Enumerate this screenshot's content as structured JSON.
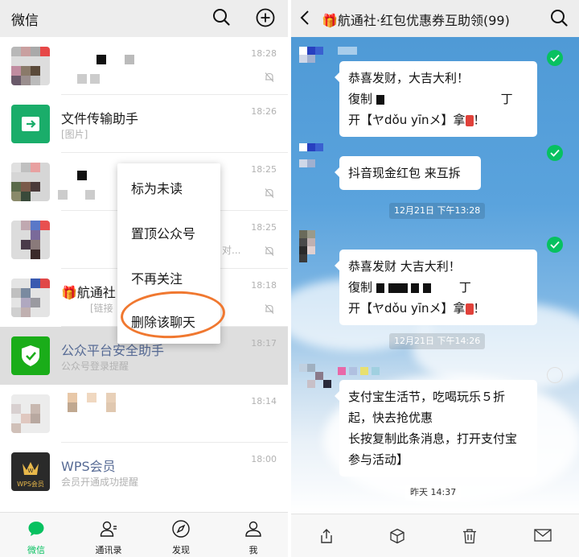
{
  "left": {
    "header_title": "微信",
    "chats": [
      {
        "name": "",
        "sub": "",
        "time": "18:28",
        "muted": true
      },
      {
        "name": "文件传输助手",
        "sub": "[图片]",
        "time": "18:26",
        "muted": false
      },
      {
        "name": "",
        "sub": "",
        "time": "18:25",
        "muted": true
      },
      {
        "name": "",
        "sub": "对...",
        "time": "18:25",
        "muted": true
      },
      {
        "name": "航通社",
        "sub": "[链接",
        "time": "18:18",
        "muted": true
      },
      {
        "name": "公众平台安全助手",
        "sub": "公众号登录提醒",
        "time": "18:17",
        "muted": false
      },
      {
        "name": "",
        "sub": "",
        "time": "18:14",
        "muted": false
      },
      {
        "name": "WPS会员",
        "sub": "会员开通成功提醒",
        "time": "18:00",
        "muted": false,
        "avatar_text": "WPS会员"
      }
    ],
    "menu": [
      "标为未读",
      "置顶公众号",
      "不再关注",
      "删除该聊天"
    ],
    "tabs": [
      "微信",
      "通讯录",
      "发现",
      "我"
    ],
    "accent": "#07c160",
    "highlight_color": "#f07830"
  },
  "right": {
    "title": "🎁航通社·红包优惠券互助领(99)",
    "messages": [
      {
        "lines": [
          "恭喜发财，大吉大利！",
          "復制",
          "开【ヤdǒu yīnメ】拿",
          "！"
        ],
        "time": ""
      },
      {
        "lines": [
          "抖音现金红包 来互拆"
        ],
        "time": "12月21日 下午13:28"
      },
      {
        "lines": [
          "恭喜发财  大吉大利！",
          "復制",
          "开【ヤdǒu yīnメ】拿",
          "！"
        ],
        "time": "12月21日 下午14:26"
      },
      {
        "lines": [
          "支付宝生活节，吃喝玩乐５折起，快去抢优惠",
          "长按复制此条消息，打开支付宝参与活动】"
        ],
        "time": "昨天 14:37"
      }
    ],
    "chars_t": "丁"
  }
}
